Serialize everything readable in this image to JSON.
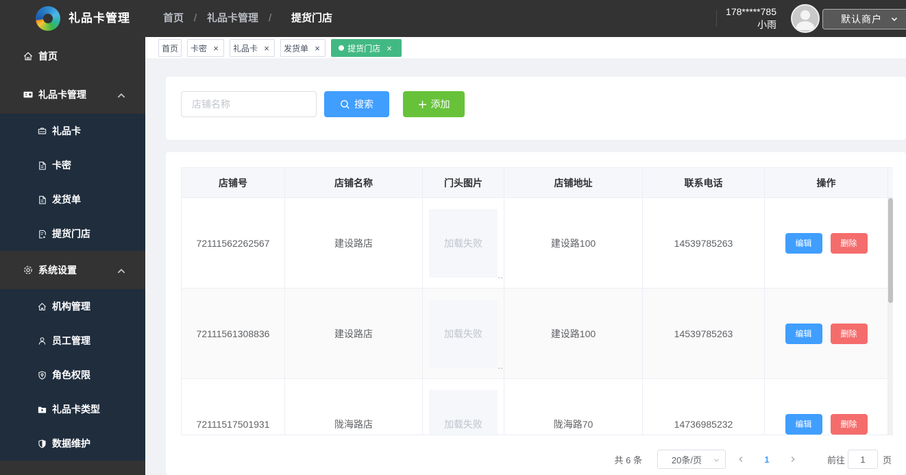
{
  "app": {
    "title": "礼品卡管理"
  },
  "header": {
    "breadcrumb": [
      "首页",
      "礼品卡管理",
      "提货门店"
    ],
    "phone": "178*****785",
    "username": "小雨",
    "merchant_label": "默认商户"
  },
  "sidebar": {
    "items": [
      {
        "label": "首页",
        "icon": "home-icon"
      },
      {
        "label": "礼品卡管理",
        "icon": "gift-card-icon",
        "expanded": true,
        "children": [
          {
            "label": "礼品卡",
            "icon": "gift-sign-icon"
          },
          {
            "label": "卡密",
            "icon": "document-icon"
          },
          {
            "label": "发货单",
            "icon": "document-icon"
          },
          {
            "label": "提货门店",
            "icon": "store-doc-icon"
          }
        ]
      },
      {
        "label": "系统设置",
        "icon": "gear-icon",
        "expanded": true,
        "children": [
          {
            "label": "机构管理",
            "icon": "org-home-icon"
          },
          {
            "label": "员工管理",
            "icon": "person-icon"
          },
          {
            "label": "角色权限",
            "icon": "shield-badge-icon"
          },
          {
            "label": "礼品卡类型",
            "icon": "folder-plus-icon"
          },
          {
            "label": "数据维护",
            "icon": "shield-half-icon"
          }
        ]
      }
    ]
  },
  "tabs": [
    {
      "label": "首页",
      "closable": false,
      "active": false
    },
    {
      "label": "卡密",
      "closable": true,
      "active": false
    },
    {
      "label": "礼品卡",
      "closable": true,
      "active": false
    },
    {
      "label": "发货单",
      "closable": true,
      "active": false
    },
    {
      "label": "提货门店",
      "closable": true,
      "active": true
    }
  ],
  "toolbar": {
    "search_placeholder": "店铺名称",
    "search_label": "搜索",
    "add_label": "添加"
  },
  "table": {
    "headers": [
      "店铺号",
      "店铺名称",
      "门头图片",
      "店铺地址",
      "联系电话",
      "操作"
    ],
    "image_error_text": "加载失败",
    "image_dots": "..",
    "rows": [
      {
        "store_no": "72111562262567",
        "name": "建设路店",
        "address": "建设路100",
        "phone": "14539785263"
      },
      {
        "store_no": "72111561308836",
        "name": "建设路店",
        "address": "建设路100",
        "phone": "14539785263"
      },
      {
        "store_no": "72111517501931",
        "name": "陇海路店",
        "address": "陇海路70",
        "phone": "14736985232"
      }
    ],
    "actions": {
      "edit": "编辑",
      "delete": "删除"
    }
  },
  "pagination": {
    "total": "共 6 条",
    "page_size": "20条/页",
    "current_page": "1",
    "goto_label": "前往",
    "goto_value": "1",
    "page_unit": "页"
  },
  "colors": {
    "header_dark": "#333333",
    "submenu_dark": "#1f2d3d",
    "accent_blue": "#409eff",
    "success_green": "#67c23a",
    "danger_red": "#f56c6c",
    "tab_active_green": "#42b983",
    "content_bg": "#f0f2f5"
  }
}
